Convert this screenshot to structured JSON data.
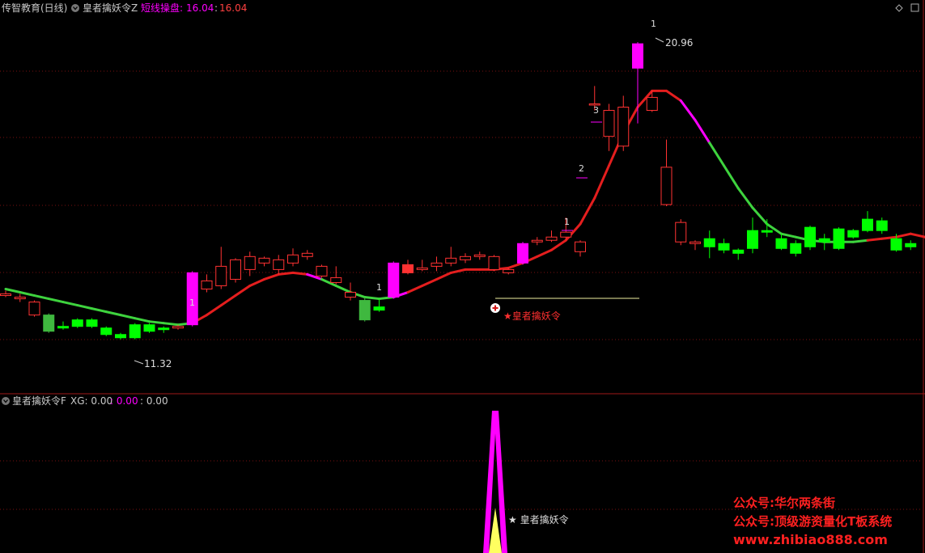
{
  "header": {
    "title": "传智教育(日线)",
    "indicator": "皇者擒妖令Z",
    "label": "短线操盘:",
    "value_a": "16.04",
    "sep": ":",
    "value_b": "16.04"
  },
  "sub_header": {
    "indicator": "皇者擒妖令F",
    "xg": "XG: 0.00",
    "v2": ": 0.00",
    "v3": ": 0.00"
  },
  "colors": {
    "up": "#ff3232",
    "down": "#00ff00",
    "signal": "#ff00ff",
    "line_red": "#e41e1e",
    "line_green": "#3ed33e",
    "grid": "#7a1010",
    "text": "#c8c8c8"
  },
  "annotations": {
    "high_label": "20.96",
    "low_label": "11.32",
    "signal_label": "★皇者擒妖令",
    "marks": [
      "1",
      "1",
      "1",
      "2",
      "3",
      "1"
    ],
    "sub_signal_label": "★ 皇者擒妖令"
  },
  "watermark": {
    "line1": "公众号:华尔两条街",
    "line2": "公众号:顶级游资量化T板系统",
    "line3": "www.zhibiao888.com"
  },
  "chart_data": {
    "type": "candlestick",
    "ylim": [
      10.6,
      21.8
    ],
    "candles": [
      {
        "o": 13.25,
        "h": 13.35,
        "l": 13.15,
        "c": 13.2,
        "t": "up"
      },
      {
        "o": 13.1,
        "h": 13.25,
        "l": 13.0,
        "c": 13.15,
        "t": "up"
      },
      {
        "o": 12.6,
        "h": 13.05,
        "l": 12.55,
        "c": 13.0,
        "t": "up"
      },
      {
        "o": 12.6,
        "h": 12.65,
        "l": 12.05,
        "c": 12.1,
        "t": "down2"
      },
      {
        "o": 12.25,
        "h": 12.4,
        "l": 12.15,
        "c": 12.2,
        "t": "down"
      },
      {
        "o": 12.45,
        "h": 12.5,
        "l": 12.2,
        "c": 12.25,
        "t": "down"
      },
      {
        "o": 12.45,
        "h": 12.5,
        "l": 12.2,
        "c": 12.25,
        "t": "down"
      },
      {
        "o": 12.2,
        "h": 12.25,
        "l": 11.95,
        "c": 12.0,
        "t": "down"
      },
      {
        "o": 12.0,
        "h": 12.05,
        "l": 11.85,
        "c": 11.9,
        "t": "down"
      },
      {
        "o": 12.3,
        "h": 12.35,
        "l": 11.85,
        "c": 11.9,
        "t": "down"
      },
      {
        "o": 12.3,
        "h": 12.35,
        "l": 12.05,
        "c": 12.1,
        "t": "down"
      },
      {
        "o": 12.2,
        "h": 12.25,
        "l": 12.05,
        "c": 12.15,
        "t": "down"
      },
      {
        "o": 12.2,
        "h": 12.3,
        "l": 12.15,
        "c": 12.25,
        "t": "up"
      },
      {
        "o": 12.3,
        "h": 13.95,
        "l": 12.25,
        "c": 13.9,
        "t": "sig"
      },
      {
        "o": 13.4,
        "h": 13.85,
        "l": 13.3,
        "c": 13.65,
        "t": "up"
      },
      {
        "o": 13.5,
        "h": 14.7,
        "l": 13.4,
        "c": 14.1,
        "t": "up"
      },
      {
        "o": 13.7,
        "h": 14.35,
        "l": 13.6,
        "c": 14.3,
        "t": "up"
      },
      {
        "o": 14.0,
        "h": 14.55,
        "l": 13.8,
        "c": 14.4,
        "t": "up"
      },
      {
        "o": 14.2,
        "h": 14.4,
        "l": 14.1,
        "c": 14.35,
        "t": "up"
      },
      {
        "o": 14.0,
        "h": 14.45,
        "l": 13.85,
        "c": 14.3,
        "t": "up"
      },
      {
        "o": 14.2,
        "h": 14.65,
        "l": 14.1,
        "c": 14.45,
        "t": "up"
      },
      {
        "o": 14.4,
        "h": 14.6,
        "l": 14.3,
        "c": 14.5,
        "t": "up"
      },
      {
        "o": 13.8,
        "h": 14.15,
        "l": 13.75,
        "c": 14.1,
        "t": "up"
      },
      {
        "o": 13.75,
        "h": 14.1,
        "l": 13.55,
        "c": 13.6,
        "t": "up"
      },
      {
        "o": 13.15,
        "h": 13.6,
        "l": 13.05,
        "c": 13.3,
        "t": "up"
      },
      {
        "o": 13.05,
        "h": 13.15,
        "l": 12.4,
        "c": 12.45,
        "t": "down2"
      },
      {
        "o": 12.85,
        "h": 13.1,
        "l": 12.7,
        "c": 12.75,
        "t": "down"
      },
      {
        "o": 13.15,
        "h": 14.25,
        "l": 13.1,
        "c": 14.2,
        "t": "sig"
      },
      {
        "o": 14.15,
        "h": 14.3,
        "l": 13.85,
        "c": 13.9,
        "t": "redfill"
      },
      {
        "o": 14.0,
        "h": 14.3,
        "l": 13.95,
        "c": 14.05,
        "t": "up"
      },
      {
        "o": 14.1,
        "h": 14.4,
        "l": 13.95,
        "c": 14.2,
        "t": "up"
      },
      {
        "o": 14.2,
        "h": 14.7,
        "l": 14.1,
        "c": 14.35,
        "t": "up"
      },
      {
        "o": 14.3,
        "h": 14.5,
        "l": 14.2,
        "c": 14.4,
        "t": "up"
      },
      {
        "o": 14.4,
        "h": 14.55,
        "l": 14.3,
        "c": 14.45,
        "t": "up"
      },
      {
        "o": 14.0,
        "h": 14.45,
        "l": 13.95,
        "c": 14.4,
        "t": "up"
      },
      {
        "o": 13.9,
        "h": 14.05,
        "l": 13.85,
        "c": 14.0,
        "t": "up"
      },
      {
        "o": 14.2,
        "h": 14.85,
        "l": 14.15,
        "c": 14.8,
        "t": "sig"
      },
      {
        "o": 14.85,
        "h": 15.0,
        "l": 14.75,
        "c": 14.9,
        "t": "up"
      },
      {
        "o": 14.9,
        "h": 15.2,
        "l": 14.85,
        "c": 15.0,
        "t": "up"
      },
      {
        "o": 15.0,
        "h": 15.6,
        "l": 14.9,
        "c": 15.15,
        "t": "up"
      },
      {
        "o": 14.55,
        "h": 14.9,
        "l": 14.4,
        "c": 14.85,
        "t": "up"
      },
      {
        "o": 19.1,
        "h": 19.65,
        "l": 18.9,
        "c": 19.1,
        "t": "up"
      },
      {
        "o": 18.1,
        "h": 19.1,
        "l": 17.65,
        "c": 18.9,
        "t": "up"
      },
      {
        "o": 17.8,
        "h": 19.35,
        "l": 17.65,
        "c": 19.0,
        "t": "up"
      },
      {
        "o": 20.2,
        "h": 21.0,
        "l": 18.5,
        "c": 20.95,
        "t": "sig"
      },
      {
        "o": 18.9,
        "h": 19.5,
        "l": 18.85,
        "c": 19.3,
        "t": "up"
      },
      {
        "o": 16.0,
        "h": 18.0,
        "l": 15.95,
        "c": 17.15,
        "t": "up"
      },
      {
        "o": 14.85,
        "h": 15.55,
        "l": 14.75,
        "c": 15.45,
        "t": "up"
      },
      {
        "o": 14.8,
        "h": 14.9,
        "l": 14.6,
        "c": 14.85,
        "t": "up"
      },
      {
        "o": 14.95,
        "h": 15.2,
        "l": 14.35,
        "c": 14.7,
        "t": "down"
      },
      {
        "o": 14.8,
        "h": 14.95,
        "l": 14.5,
        "c": 14.6,
        "t": "down"
      },
      {
        "o": 14.6,
        "h": 14.65,
        "l": 14.3,
        "c": 14.5,
        "t": "down"
      },
      {
        "o": 15.2,
        "h": 15.6,
        "l": 14.5,
        "c": 14.65,
        "t": "down"
      },
      {
        "o": 15.2,
        "h": 15.55,
        "l": 15.0,
        "c": 15.15,
        "t": "down"
      },
      {
        "o": 14.95,
        "h": 15.1,
        "l": 14.6,
        "c": 14.65,
        "t": "down"
      },
      {
        "o": 14.8,
        "h": 14.9,
        "l": 14.4,
        "c": 14.5,
        "t": "down"
      },
      {
        "o": 15.3,
        "h": 15.35,
        "l": 14.6,
        "c": 14.7,
        "t": "down"
      },
      {
        "o": 14.85,
        "h": 15.1,
        "l": 14.6,
        "c": 14.95,
        "t": "down"
      },
      {
        "o": 15.25,
        "h": 15.3,
        "l": 14.6,
        "c": 14.65,
        "t": "down"
      },
      {
        "o": 15.2,
        "h": 15.25,
        "l": 14.95,
        "c": 15.0,
        "t": "down"
      },
      {
        "o": 15.55,
        "h": 15.8,
        "l": 15.15,
        "c": 15.2,
        "t": "down"
      },
      {
        "o": 15.5,
        "h": 15.6,
        "l": 15.1,
        "c": 15.2,
        "t": "down"
      },
      {
        "o": 14.95,
        "h": 15.1,
        "l": 14.55,
        "c": 14.6,
        "t": "down"
      },
      {
        "o": 14.8,
        "h": 14.9,
        "l": 14.6,
        "c": 14.7,
        "t": "down"
      }
    ],
    "line": [
      13.4,
      13.3,
      13.2,
      13.1,
      13.0,
      12.9,
      12.8,
      12.7,
      12.6,
      12.5,
      12.4,
      12.35,
      12.3,
      12.35,
      12.6,
      12.9,
      13.2,
      13.5,
      13.7,
      13.85,
      13.9,
      13.85,
      13.7,
      13.5,
      13.3,
      13.15,
      13.1,
      13.15,
      13.3,
      13.5,
      13.7,
      13.9,
      14.0,
      14.0,
      14.0,
      14.05,
      14.2,
      14.4,
      14.6,
      14.9,
      15.4,
      16.2,
      17.2,
      18.2,
      19.0,
      19.5,
      19.5,
      19.2,
      18.6,
      17.9,
      17.2,
      16.5,
      15.9,
      15.4,
      15.1,
      15.0,
      14.9,
      14.85,
      14.85,
      14.85,
      14.9,
      14.95,
      15.0,
      15.1,
      15.0,
      14.95
    ],
    "line_colors": [
      "g",
      "g",
      "g",
      "g",
      "g",
      "g",
      "g",
      "g",
      "g",
      "g",
      "g",
      "g",
      "g",
      "r",
      "r",
      "r",
      "r",
      "r",
      "r",
      "r",
      "r",
      "m",
      "g",
      "g",
      "g",
      "g",
      "g",
      "m",
      "r",
      "r",
      "r",
      "r",
      "r",
      "r",
      "r",
      "r",
      "r",
      "r",
      "r",
      "r",
      "r",
      "r",
      "r",
      "r",
      "r",
      "r",
      "r",
      "m",
      "m",
      "g",
      "g",
      "g",
      "g",
      "g",
      "g",
      "g",
      "g",
      "g",
      "g",
      "g",
      "r",
      "r",
      "r",
      "r",
      "r",
      "r"
    ],
    "sub_signal": {
      "peak": 1,
      "base": 0
    }
  }
}
